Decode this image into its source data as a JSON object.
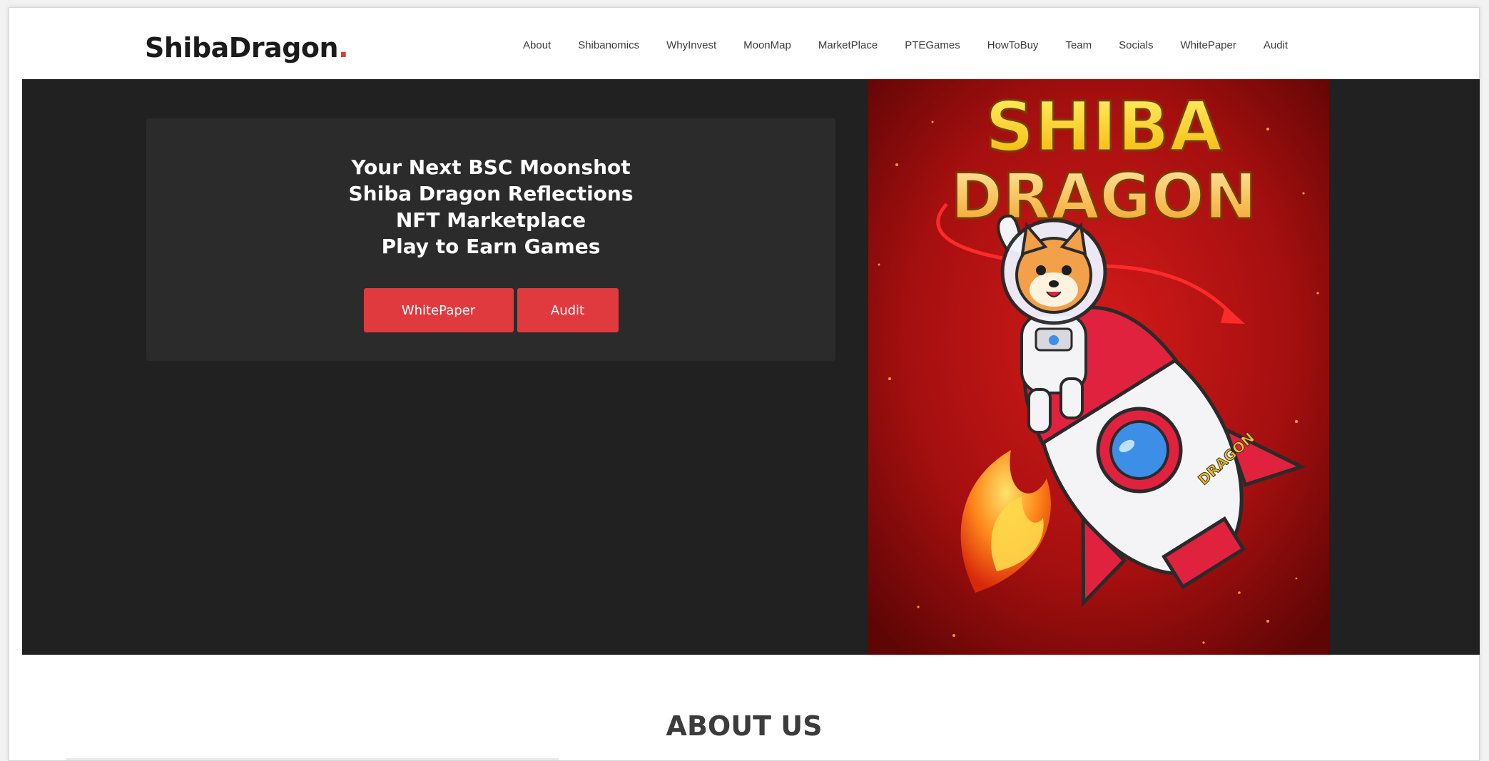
{
  "brand": {
    "name": "ShibaDragon",
    "dot": "."
  },
  "nav": {
    "items": [
      "About",
      "Shibanomics",
      "WhyInvest",
      "MoonMap",
      "MarketPlace",
      "PTEGames",
      "HowToBuy",
      "Team",
      "Socials",
      "WhitePaper",
      "Audit"
    ]
  },
  "hero": {
    "lines": [
      "Your Next BSC Moonshot",
      "Shiba Dragon Reflections",
      "NFT Marketplace",
      "Play to Earn Games"
    ],
    "buttons": {
      "whitepaper": "WhitePaper",
      "audit": "Audit"
    },
    "art": {
      "title_top": "SHIBA",
      "title_bottom": "DRAGON",
      "rocket_label": "DRAGON"
    }
  },
  "about": {
    "title": "ABOUT US"
  },
  "colors": {
    "accent": "#e03a3e",
    "hero_bg": "#212121",
    "card_bg": "#2b2b2b",
    "art_red": "#b31212"
  }
}
